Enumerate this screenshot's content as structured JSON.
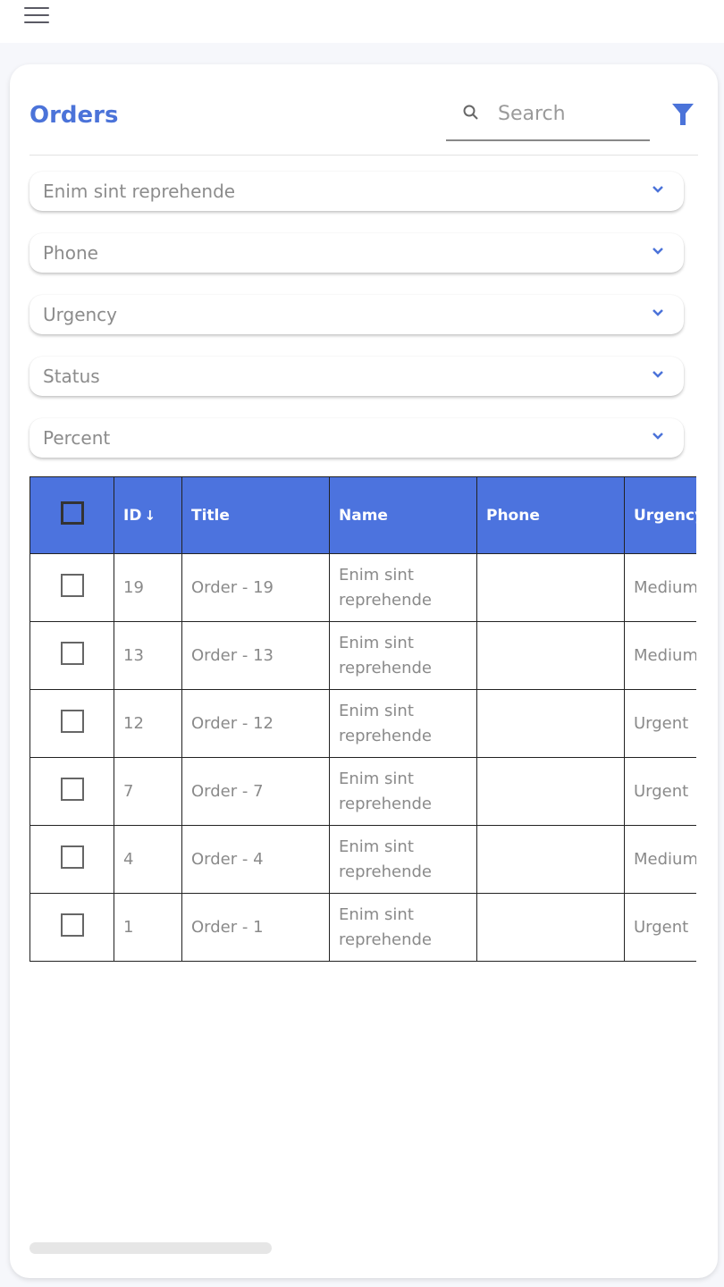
{
  "app": {
    "menu_icon": "hamburger-menu-icon"
  },
  "header": {
    "title": "Orders",
    "search_placeholder": "Search",
    "search_value": "",
    "search_icon": "search-icon",
    "filter_icon": "filter-funnel-icon"
  },
  "filters": [
    {
      "label": "Enim sint reprehende"
    },
    {
      "label": "Phone"
    },
    {
      "label": "Urgency"
    },
    {
      "label": "Status"
    },
    {
      "label": "Percent"
    }
  ],
  "colors": {
    "accent": "#4b73d9",
    "header_bg": "#4c73de"
  },
  "table": {
    "columns": [
      "",
      "ID",
      "Title",
      "Name",
      "Phone",
      "Urgency"
    ],
    "sort": {
      "column": "ID",
      "direction": "desc",
      "icon": "↓"
    },
    "rows": [
      {
        "id": "19",
        "title": "Order - 19",
        "name": "Enim sint reprehende",
        "phone": "",
        "urgency": "Medium"
      },
      {
        "id": "13",
        "title": "Order - 13",
        "name": "Enim sint reprehende",
        "phone": "",
        "urgency": "Medium"
      },
      {
        "id": "12",
        "title": "Order - 12",
        "name": "Enim sint reprehende",
        "phone": "",
        "urgency": "Urgent"
      },
      {
        "id": "7",
        "title": "Order - 7",
        "name": "Enim sint reprehende",
        "phone": "",
        "urgency": "Urgent"
      },
      {
        "id": "4",
        "title": "Order - 4",
        "name": "Enim sint reprehende",
        "phone": "",
        "urgency": "Medium"
      },
      {
        "id": "1",
        "title": "Order - 1",
        "name": "Enim sint reprehende",
        "phone": "",
        "urgency": "Urgent"
      }
    ]
  }
}
